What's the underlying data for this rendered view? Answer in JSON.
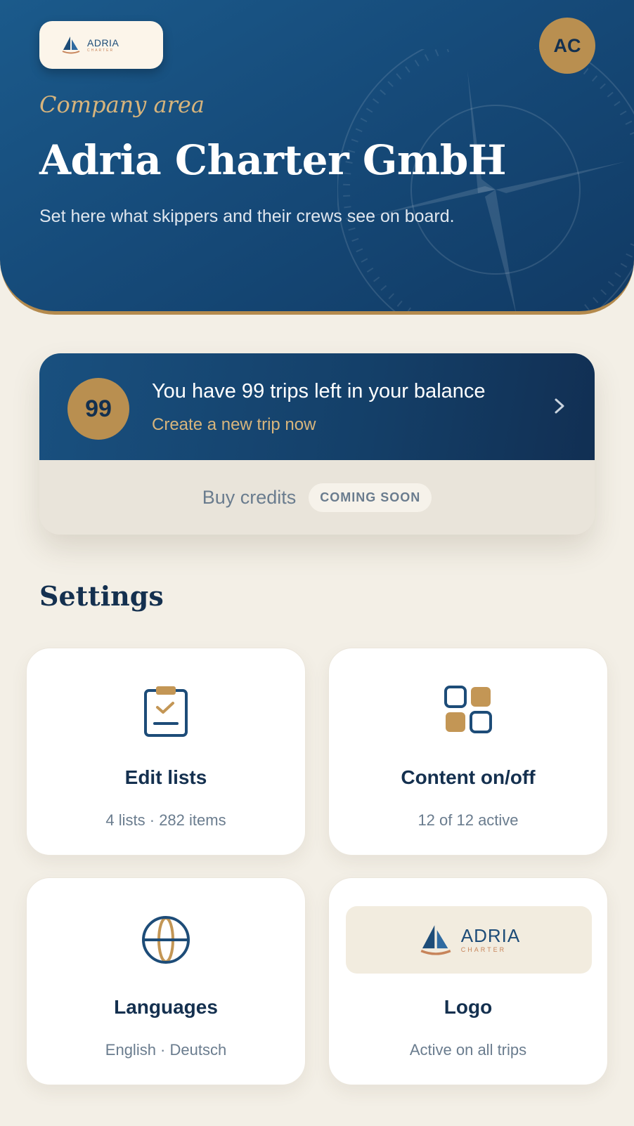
{
  "header": {
    "logo": {
      "name": "ADRIA",
      "sub": "CHARTER"
    },
    "avatar_initials": "AC",
    "eyebrow": "Company area",
    "company_name": "Adria Charter GmbH",
    "subtitle": "Set here what skippers and their crews see on board."
  },
  "credits": {
    "count": "99",
    "title": "You have 99 trips left in your balance",
    "link": "Create a new trip now",
    "buy_label": "Buy credits",
    "badge": "COMING SOON"
  },
  "settings": {
    "title": "Settings",
    "tiles": [
      {
        "icon": "clipboard-check-icon",
        "title": "Edit lists",
        "subtitle": "4 lists · 282 items"
      },
      {
        "icon": "grid-toggle-icon",
        "title": "Content on/off",
        "subtitle": "12 of 12 active"
      },
      {
        "icon": "globe-icon",
        "title": "Languages",
        "subtitle": "English · Deutsch"
      },
      {
        "icon": "logo-preview",
        "title": "Logo",
        "subtitle": "Active on all trips",
        "logo": {
          "name": "ADRIA",
          "sub": "CHARTER"
        }
      }
    ]
  },
  "colors": {
    "navy": "#14304f",
    "hero_blue": "#1b5a8b",
    "gold": "#b98f50",
    "background": "#f3efe6"
  }
}
